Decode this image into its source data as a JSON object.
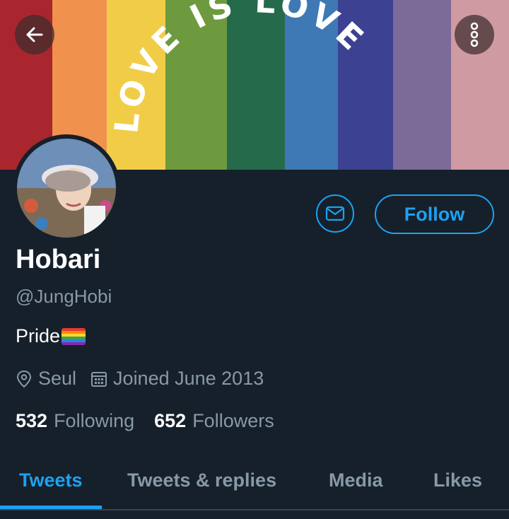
{
  "header": {
    "back_icon": "arrow-left-icon",
    "more_icon": "more-vertical-icon",
    "banner_text": [
      "LOVE",
      "IS",
      "LOVE"
    ],
    "banner_colors": [
      "#a9262e",
      "#f0914e",
      "#f1cd47",
      "#6d9a3f",
      "#256a4b",
      "#3e78b5",
      "#3c4191",
      "#7c6a99",
      "#cf9aa1"
    ]
  },
  "profile": {
    "name": "Hobari",
    "handle": "@JungHobi",
    "bio": "Pride",
    "bio_flag": "rainbow-flag-icon",
    "location": "Seul",
    "joined": "Joined June 2013",
    "following_count": "532",
    "following_label": "Following",
    "followers_count": "652",
    "followers_label": "Followers"
  },
  "actions": {
    "message_icon": "mail-icon",
    "follow_label": "Follow"
  },
  "tabs": [
    {
      "label": "Tweets",
      "active": true
    },
    {
      "label": "Tweets & replies",
      "active": false
    },
    {
      "label": "Media",
      "active": false
    },
    {
      "label": "Likes",
      "active": false
    }
  ],
  "colors": {
    "background": "#15202b",
    "accent": "#1da1f2",
    "secondary_text": "#8899a6",
    "primary_text": "#ffffff"
  }
}
